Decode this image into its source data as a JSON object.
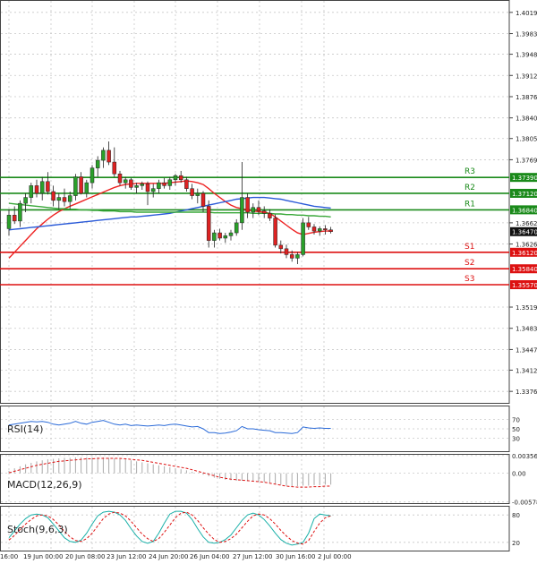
{
  "chart_data": {
    "type": "candlestick",
    "title": "",
    "price_axis": {
      "ticks": [
        "1.40190",
        "1.39830",
        "1.39480",
        "1.39120",
        "1.38760",
        "1.38400",
        "1.38050",
        "1.37690",
        "1.36620",
        "1.36260",
        "1.35190",
        "1.34830",
        "1.34470",
        "1.34120",
        "1.33760"
      ],
      "range": [
        1.3355,
        1.404
      ],
      "current_price": "1.36470"
    },
    "time_axis": {
      "labels": [
        "16:00",
        "19 Jun 00:00",
        "20 Jun 08:00",
        "23 Jun 12:00",
        "24 Jun 20:00",
        "26 Jun 04:00",
        "27 Jun 12:00",
        "30 Jun 16:00",
        "2 Jul 00:00"
      ]
    },
    "pivot_levels": [
      {
        "name": "R3",
        "value": 1.3739,
        "label": "1.37390",
        "color": "#1a8a1a"
      },
      {
        "name": "R2",
        "value": 1.3712,
        "label": "1.37120",
        "color": "#1a8a1a"
      },
      {
        "name": "R1",
        "value": 1.3684,
        "label": "1.36840",
        "color": "#1a8a1a"
      },
      {
        "name": "S1",
        "value": 1.3612,
        "label": "1.36120",
        "color": "#dd1111"
      },
      {
        "name": "S2",
        "value": 1.3584,
        "label": "1.35840",
        "color": "#dd1111"
      },
      {
        "name": "S3",
        "value": 1.3557,
        "label": "1.35570",
        "color": "#dd1111"
      }
    ],
    "candles": [
      [
        1.3652,
        1.3685,
        1.364,
        1.3675
      ],
      [
        1.3675,
        1.369,
        1.366,
        1.3665
      ],
      [
        1.3665,
        1.37,
        1.3655,
        1.3695
      ],
      [
        1.3695,
        1.3712,
        1.368,
        1.3705
      ],
      [
        1.3705,
        1.373,
        1.3695,
        1.3725
      ],
      [
        1.3725,
        1.3735,
        1.3705,
        1.3712
      ],
      [
        1.3712,
        1.374,
        1.37,
        1.3732
      ],
      [
        1.3732,
        1.3748,
        1.371,
        1.3715
      ],
      [
        1.3715,
        1.3725,
        1.369,
        1.37
      ],
      [
        1.37,
        1.3712,
        1.3685,
        1.3705
      ],
      [
        1.3705,
        1.372,
        1.369,
        1.3698
      ],
      [
        1.3698,
        1.3715,
        1.3685,
        1.3708
      ],
      [
        1.3708,
        1.3745,
        1.37,
        1.374
      ],
      [
        1.374,
        1.3748,
        1.371,
        1.3712
      ],
      [
        1.3712,
        1.3735,
        1.3705,
        1.373
      ],
      [
        1.373,
        1.376,
        1.372,
        1.3755
      ],
      [
        1.3755,
        1.3775,
        1.374,
        1.3768
      ],
      [
        1.3768,
        1.379,
        1.3755,
        1.3785
      ],
      [
        1.3785,
        1.38,
        1.376,
        1.3765
      ],
      [
        1.3765,
        1.379,
        1.374,
        1.3745
      ],
      [
        1.3745,
        1.375,
        1.3725,
        1.373
      ],
      [
        1.373,
        1.374,
        1.372,
        1.3735
      ],
      [
        1.3735,
        1.3738,
        1.3718,
        1.3722
      ],
      [
        1.3722,
        1.373,
        1.3712,
        1.3725
      ],
      [
        1.3725,
        1.3732,
        1.3718,
        1.3728
      ],
      [
        1.3728,
        1.3732,
        1.3692,
        1.3715
      ],
      [
        1.3715,
        1.3728,
        1.3705,
        1.372
      ],
      [
        1.372,
        1.3735,
        1.3712,
        1.373
      ],
      [
        1.373,
        1.3738,
        1.372,
        1.3725
      ],
      [
        1.3725,
        1.374,
        1.3718,
        1.3735
      ],
      [
        1.3735,
        1.3745,
        1.3725,
        1.3742
      ],
      [
        1.3742,
        1.375,
        1.373,
        1.3735
      ],
      [
        1.3735,
        1.374,
        1.3715,
        1.372
      ],
      [
        1.372,
        1.3728,
        1.3702,
        1.3708
      ],
      [
        1.3708,
        1.372,
        1.3695,
        1.3712
      ],
      [
        1.3712,
        1.3716,
        1.368,
        1.369
      ],
      [
        1.369,
        1.37,
        1.362,
        1.3632
      ],
      [
        1.3632,
        1.365,
        1.362,
        1.3645
      ],
      [
        1.3645,
        1.3652,
        1.3632,
        1.3636
      ],
      [
        1.3636,
        1.3645,
        1.3628,
        1.364
      ],
      [
        1.364,
        1.365,
        1.3632,
        1.3645
      ],
      [
        1.3645,
        1.3668,
        1.364,
        1.3662
      ],
      [
        1.3662,
        1.3765,
        1.365,
        1.3705
      ],
      [
        1.3705,
        1.3712,
        1.367,
        1.368
      ],
      [
        1.368,
        1.3695,
        1.367,
        1.3688
      ],
      [
        1.3688,
        1.37,
        1.3675,
        1.3682
      ],
      [
        1.3682,
        1.369,
        1.367,
        1.3678
      ],
      [
        1.3678,
        1.3685,
        1.3665,
        1.367
      ],
      [
        1.367,
        1.3676,
        1.362,
        1.3624
      ],
      [
        1.3624,
        1.3632,
        1.361,
        1.3618
      ],
      [
        1.3618,
        1.3625,
        1.3602,
        1.3608
      ],
      [
        1.3608,
        1.3615,
        1.3596,
        1.3602
      ],
      [
        1.3602,
        1.3612,
        1.3592,
        1.3608
      ],
      [
        1.3608,
        1.367,
        1.3605,
        1.3662
      ],
      [
        1.3662,
        1.3672,
        1.365,
        1.3655
      ],
      [
        1.3655,
        1.366,
        1.3642,
        1.3648
      ],
      [
        1.3648,
        1.3656,
        1.364,
        1.3652
      ],
      [
        1.3652,
        1.3658,
        1.3642,
        1.365
      ],
      [
        1.365,
        1.3655,
        1.3644,
        1.3647
      ]
    ],
    "moving_averages": [
      {
        "color": "#ee2222",
        "values": [
          1.3602,
          1.3612,
          1.3622,
          1.3632,
          1.3642,
          1.3652,
          1.366,
          1.3668,
          1.3675,
          1.3681,
          1.3686,
          1.369,
          1.3694,
          1.3698,
          1.3702,
          1.3706,
          1.371,
          1.3714,
          1.3718,
          1.3722,
          1.3725,
          1.3727,
          1.3728,
          1.3729,
          1.3729,
          1.3729,
          1.3729,
          1.3729,
          1.3729,
          1.373,
          1.3731,
          1.3732,
          1.3733,
          1.3732,
          1.373,
          1.3727,
          1.372,
          1.3712,
          1.3705,
          1.3698,
          1.3692,
          1.3688,
          1.3686,
          1.3684,
          1.3682,
          1.3681,
          1.368,
          1.3678,
          1.3672,
          1.3665,
          1.3658,
          1.3651,
          1.3645,
          1.3642,
          1.3644,
          1.3646,
          1.3647,
          1.3648,
          1.3648
        ]
      },
      {
        "color": "#2a5ad8",
        "values": [
          1.365,
          1.3651,
          1.3652,
          1.3653,
          1.3654,
          1.3655,
          1.3656,
          1.3657,
          1.3658,
          1.3659,
          1.366,
          1.3661,
          1.3662,
          1.3663,
          1.3664,
          1.3665,
          1.3666,
          1.3667,
          1.3668,
          1.3669,
          1.367,
          1.3671,
          1.3672,
          1.3672,
          1.3673,
          1.3674,
          1.3675,
          1.3676,
          1.3677,
          1.3678,
          1.368,
          1.3682,
          1.3684,
          1.3686,
          1.3688,
          1.369,
          1.3692,
          1.3694,
          1.3696,
          1.3698,
          1.37,
          1.3702,
          1.3703,
          1.3704,
          1.3705,
          1.3705,
          1.3705,
          1.3704,
          1.3703,
          1.3702,
          1.37,
          1.3698,
          1.3696,
          1.3694,
          1.3692,
          1.369,
          1.3689,
          1.3688,
          1.3687
        ]
      },
      {
        "color": "#3aa83a",
        "values": [
          1.3695,
          1.3694,
          1.3693,
          1.3692,
          1.3691,
          1.369,
          1.3689,
          1.3688,
          1.3687,
          1.3686,
          1.3686,
          1.3685,
          1.3685,
          1.3684,
          1.3684,
          1.3683,
          1.3683,
          1.3682,
          1.3682,
          1.3682,
          1.3681,
          1.3681,
          1.3681,
          1.368,
          1.368,
          1.368,
          1.368,
          1.368,
          1.368,
          1.368,
          1.368,
          1.368,
          1.368,
          1.368,
          1.368,
          1.368,
          1.368,
          1.3679,
          1.3679,
          1.3679,
          1.3679,
          1.3679,
          1.3679,
          1.3679,
          1.3678,
          1.3678,
          1.3678,
          1.3678,
          1.3677,
          1.3677,
          1.3676,
          1.3676,
          1.3675,
          1.3675,
          1.3674,
          1.3674,
          1.3673,
          1.3673,
          1.3672
        ]
      }
    ],
    "rsi": {
      "label": "RSI(14)",
      "ticks": [
        "70",
        "50",
        "30"
      ],
      "values": [
        58,
        60,
        62,
        64,
        66,
        65,
        66,
        64,
        60,
        58,
        60,
        62,
        66,
        62,
        60,
        64,
        66,
        68,
        64,
        60,
        58,
        60,
        57,
        58,
        57,
        56,
        57,
        58,
        57,
        59,
        60,
        58,
        56,
        54,
        55,
        50,
        42,
        42,
        40,
        41,
        43,
        46,
        55,
        50,
        50,
        48,
        47,
        46,
        42,
        42,
        41,
        40,
        42,
        54,
        52,
        51,
        52,
        51,
        51
      ],
      "color": "#2a6ad8"
    },
    "macd": {
      "label": "MACD(12,26,9)",
      "ticks": [
        "0.00356",
        "0.00",
        "-0.00578"
      ],
      "range": [
        -0.0062,
        0.0039
      ],
      "histogram": [
        0.0005,
        0.001,
        0.0014,
        0.0018,
        0.0021,
        0.0024,
        0.0026,
        0.0028,
        0.0029,
        0.003,
        0.0031,
        0.0031,
        0.0032,
        0.0032,
        0.0032,
        0.0032,
        0.0032,
        0.0032,
        0.0031,
        0.003,
        0.0029,
        0.0028,
        0.0026,
        0.0024,
        0.0022,
        0.002,
        0.0018,
        0.0016,
        0.0014,
        0.0012,
        0.001,
        0.0008,
        0.0006,
        0.0003,
        0.0,
        -0.0003,
        -0.0006,
        -0.0009,
        -0.0011,
        -0.0013,
        -0.0014,
        -0.0015,
        -0.0015,
        -0.0016,
        -0.0016,
        -0.0017,
        -0.0018,
        -0.0019,
        -0.0021,
        -0.0023,
        -0.0025,
        -0.0026,
        -0.0026,
        -0.0025,
        -0.0025,
        -0.0024,
        -0.0024,
        -0.0023,
        -0.0023
      ],
      "signal": [
        0.0001,
        0.0004,
        0.0007,
        0.001,
        0.0013,
        0.0016,
        0.0018,
        0.002,
        0.0022,
        0.0024,
        0.0025,
        0.0026,
        0.0027,
        0.0028,
        0.0029,
        0.0029,
        0.003,
        0.003,
        0.003,
        0.003,
        0.003,
        0.0029,
        0.0028,
        0.0027,
        0.0026,
        0.0024,
        0.0022,
        0.002,
        0.0018,
        0.0016,
        0.0014,
        0.0012,
        0.001,
        0.0007,
        0.0004,
        0.0001,
        -0.0002,
        -0.0005,
        -0.0008,
        -0.001,
        -0.0012,
        -0.0013,
        -0.0014,
        -0.0015,
        -0.0016,
        -0.0017,
        -0.0018,
        -0.002,
        -0.0022,
        -0.0024,
        -0.0026,
        -0.0027,
        -0.0028,
        -0.0028,
        -0.0028,
        -0.0027,
        -0.0027,
        -0.0026,
        -0.0026
      ],
      "hist_color": "#aaaaaa",
      "signal_color": "#dd1111"
    },
    "stochastic": {
      "label": "Stoch(9,6,3)",
      "ticks": [
        "80",
        "20"
      ],
      "k": [
        30,
        45,
        60,
        72,
        80,
        82,
        80,
        74,
        60,
        45,
        30,
        22,
        20,
        25,
        40,
        60,
        78,
        86,
        88,
        86,
        80,
        68,
        50,
        34,
        22,
        18,
        22,
        40,
        62,
        82,
        88,
        88,
        84,
        70,
        50,
        32,
        20,
        18,
        20,
        26,
        36,
        52,
        68,
        80,
        84,
        80,
        70,
        56,
        40,
        26,
        18,
        14,
        16,
        20,
        40,
        72,
        82,
        80,
        78
      ],
      "d": [
        25,
        35,
        48,
        60,
        70,
        78,
        80,
        78,
        70,
        58,
        44,
        32,
        24,
        22,
        28,
        40,
        56,
        72,
        82,
        86,
        84,
        78,
        66,
        52,
        38,
        28,
        22,
        28,
        42,
        58,
        74,
        84,
        86,
        80,
        68,
        52,
        38,
        26,
        20,
        22,
        28,
        38,
        52,
        66,
        78,
        82,
        80,
        72,
        60,
        46,
        34,
        24,
        18,
        16,
        24,
        44,
        62,
        74,
        78
      ],
      "k_color": "#1ab0a8",
      "d_color": "#dd1111"
    }
  }
}
